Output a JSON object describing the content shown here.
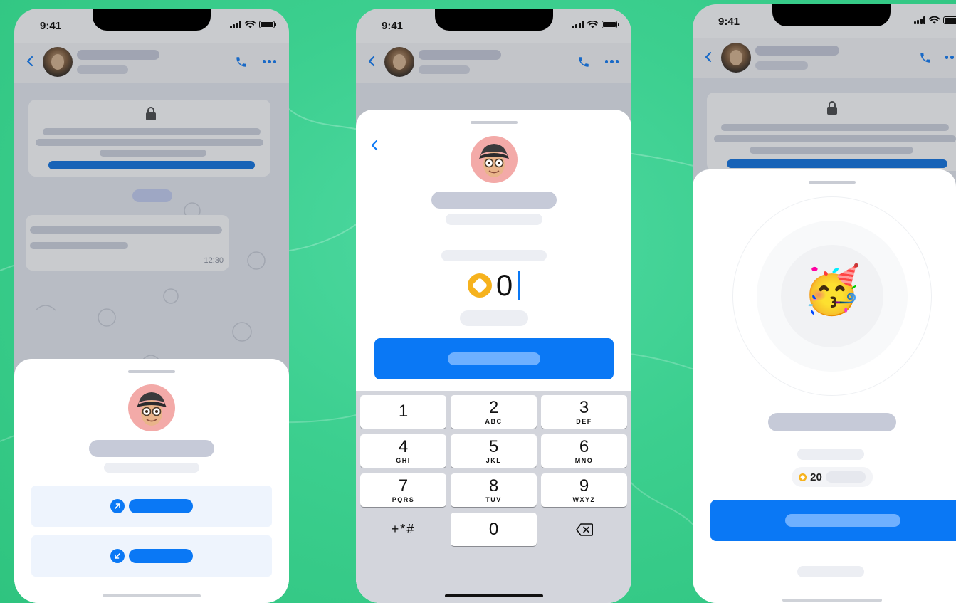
{
  "status_bar": {
    "time": "9:41"
  },
  "screen_1": {
    "chat": {
      "message_time": "12:30"
    },
    "sheet": {
      "actions": [
        {
          "icon": "arrow-up-right-icon"
        },
        {
          "icon": "arrow-down-left-icon"
        }
      ]
    }
  },
  "screen_2": {
    "amount": "0",
    "keypad": {
      "keys": [
        {
          "num": "1",
          "letters": ""
        },
        {
          "num": "2",
          "letters": "ABC"
        },
        {
          "num": "3",
          "letters": "DEF"
        },
        {
          "num": "4",
          "letters": "GHI"
        },
        {
          "num": "5",
          "letters": "JKL"
        },
        {
          "num": "6",
          "letters": "MNO"
        },
        {
          "num": "7",
          "letters": "PQRS"
        },
        {
          "num": "8",
          "letters": "TUV"
        },
        {
          "num": "9",
          "letters": "WXYZ"
        }
      ],
      "symbols": "+*#",
      "zero": "0"
    }
  },
  "screen_3": {
    "reward_amount": "20",
    "emoji": "🥳"
  },
  "colors": {
    "accent": "#0a78f5",
    "coin": "#f6b21d",
    "background": "#3ccf8f",
    "avatar_bg": "#f3aaa8"
  }
}
